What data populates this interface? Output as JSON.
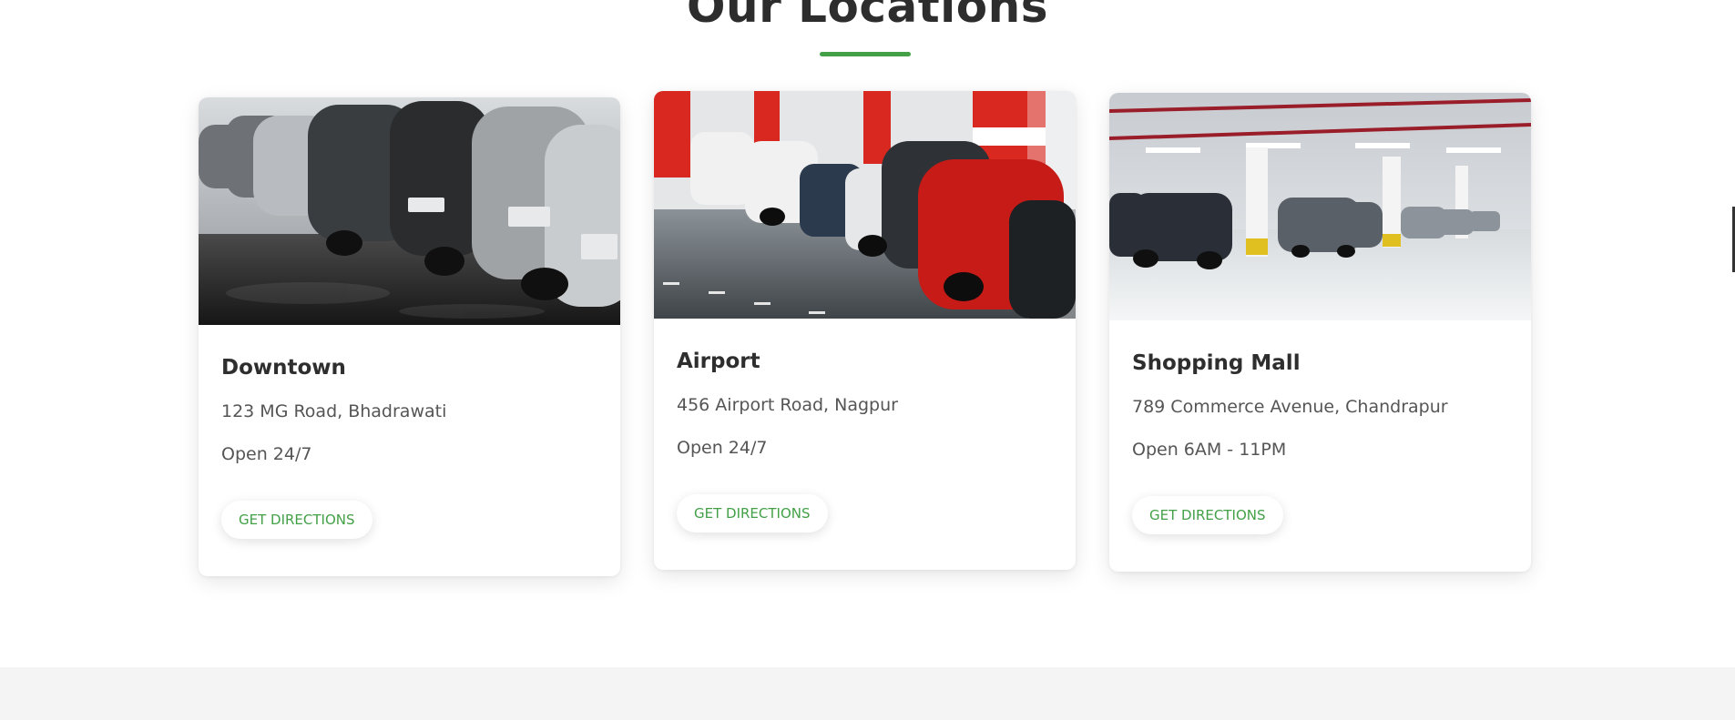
{
  "section": {
    "title": "Our Locations",
    "accent_color": "#43a047"
  },
  "locations": [
    {
      "name": "Downtown",
      "address": "123 MG Road, Bhadrawati",
      "hours": "Open 24/7",
      "button_label": "GET DIRECTIONS",
      "image": "row of parked cars outdoors"
    },
    {
      "name": "Airport",
      "address": "456 Airport Road, Nagpur",
      "hours": "Open 24/7",
      "button_label": "GET DIRECTIONS",
      "image": "parking garage with red pillars and red car"
    },
    {
      "name": "Shopping Mall",
      "address": "789 Commerce Avenue, Chandrapur",
      "hours": "Open 6AM - 11PM",
      "button_label": "GET DIRECTIONS",
      "image": "underground parking garage with white columns"
    }
  ]
}
